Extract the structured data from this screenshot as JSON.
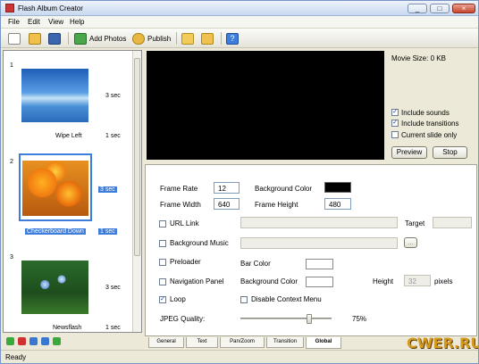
{
  "window": {
    "title": "Flash Album Creator",
    "btn_min": "_",
    "btn_max": "□",
    "btn_close": "×"
  },
  "menu": [
    "File",
    "Edit",
    "View",
    "Help"
  ],
  "toolbar": {
    "add_photos": "Add Photos",
    "publish": "Publish"
  },
  "slides": [
    {
      "number": "1",
      "duration": "3 sec",
      "transition": "Wipe Left",
      "transition_duration": "1 sec"
    },
    {
      "number": "2",
      "duration": "3 sec",
      "transition": "Checkerboard Down",
      "transition_duration": "1 sec"
    },
    {
      "number": "3",
      "duration": "3 sec",
      "transition": "Newsflash",
      "transition_duration": "1 sec"
    }
  ],
  "preview": {
    "movie_size": "Movie Size: 0 KB",
    "include_sounds": "Include sounds",
    "include_transitions": "Include transitions",
    "current_slide_only": "Current slide only",
    "preview_button": "Preview",
    "stop_button": "Stop"
  },
  "settings": {
    "frame_rate_label": "Frame Rate",
    "frame_rate": "12",
    "bg_color_label": "Background Color",
    "frame_width_label": "Frame Width",
    "frame_width": "640",
    "frame_height_label": "Frame Height",
    "frame_height": "480",
    "url_link_label": "URL Link",
    "target_label": "Target",
    "bg_music_label": "Background Music",
    "browse": "...",
    "preloader_label": "Preloader",
    "bar_color_label": "Bar Color",
    "nav_panel_label": "Navigation Panel",
    "nav_bg_color_label": "Background Color",
    "height_label": "Height",
    "height_value": "32",
    "pixels_label": "pixels",
    "loop_label": "Loop",
    "disable_menu_label": "Disable Context Menu",
    "jpeg_quality_label": "JPEG Quality:",
    "jpeg_quality": "75%"
  },
  "tabs": [
    "General",
    "Text",
    "Pan/Zoom",
    "Transition",
    "Global"
  ],
  "status": "Ready",
  "watermark": "CWER.RU",
  "colors": {
    "accent": "#3d7ddc",
    "preview_bg": "#000000"
  }
}
